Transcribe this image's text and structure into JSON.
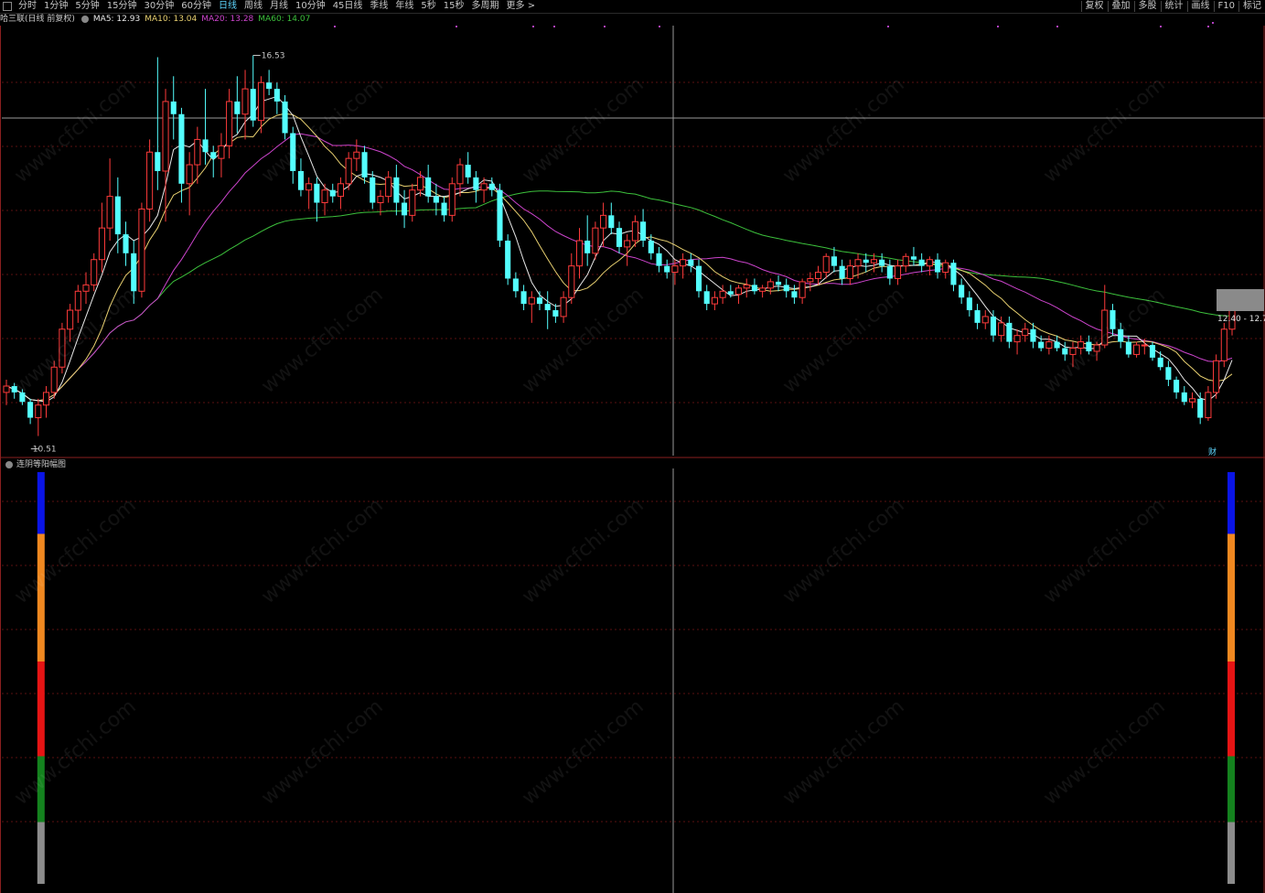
{
  "toolbar": {
    "items": [
      "分时",
      "1分钟",
      "5分钟",
      "15分钟",
      "30分钟",
      "60分钟",
      "日线",
      "周线",
      "月线",
      "10分钟",
      "45日线",
      "季线",
      "年线",
      "5秒",
      "15秒",
      "多周期",
      "更多 >"
    ],
    "active": "日线",
    "right_items": [
      "复权",
      "叠加",
      "多股",
      "统计",
      "画线",
      "F10",
      "标记"
    ]
  },
  "header": {
    "stock": "哈三联(日线 前复权)",
    "ma5": "MA5: 12.93",
    "ma10": "MA10: 13.04",
    "ma20": "MA20: 13.28",
    "ma60": "MA60: 14.07"
  },
  "labels": {
    "high": "16.53",
    "low": "10.51",
    "price_tag": "12.40 - 12.7",
    "cai": "财",
    "indicator": "连阴等阳幅图"
  },
  "colors": {
    "up": "#ff3b3b",
    "down": "#54ffff",
    "ma5": "#e8e8e8",
    "ma10": "#e8d070",
    "ma20": "#cc44cc",
    "ma60": "#3cc03c",
    "indicator_segments": [
      "#0a14e6",
      "#f08820",
      "#e61414",
      "#14821e",
      "#8c8c8c"
    ]
  },
  "chart_data": [
    {
      "type": "candlestick",
      "title": "哈三联(日线 前复权)",
      "ylim": [
        10.2,
        17.0
      ],
      "series": [
        {
          "name": "MA5",
          "last": 12.93
        },
        {
          "name": "MA10",
          "last": 13.04
        },
        {
          "name": "MA20",
          "last": 13.28
        },
        {
          "name": "MA60",
          "last": 14.07
        }
      ],
      "annotations": [
        {
          "label": "16.53",
          "kind": "high"
        },
        {
          "label": "10.51",
          "kind": "low"
        }
      ],
      "candles_ohlc": [
        [
          11.2,
          11.4,
          11.0,
          11.3
        ],
        [
          11.3,
          11.35,
          11.1,
          11.2
        ],
        [
          11.2,
          11.25,
          11.0,
          11.05
        ],
        [
          11.05,
          11.1,
          10.7,
          10.8
        ],
        [
          10.8,
          11.1,
          10.51,
          11.0
        ],
        [
          11.0,
          11.3,
          10.8,
          11.2
        ],
        [
          11.2,
          11.7,
          11.1,
          11.6
        ],
        [
          11.6,
          12.3,
          11.5,
          12.2
        ],
        [
          12.2,
          12.6,
          12.0,
          12.5
        ],
        [
          12.5,
          12.9,
          12.3,
          12.8
        ],
        [
          12.8,
          13.1,
          12.6,
          12.9
        ],
        [
          12.9,
          13.4,
          12.8,
          13.3
        ],
        [
          13.3,
          14.2,
          13.1,
          13.8
        ],
        [
          13.8,
          14.9,
          13.6,
          14.3
        ],
        [
          14.3,
          14.6,
          13.4,
          13.7
        ],
        [
          13.7,
          13.9,
          13.2,
          13.4
        ],
        [
          13.4,
          13.6,
          12.6,
          12.8
        ],
        [
          12.8,
          14.2,
          12.7,
          14.1
        ],
        [
          14.1,
          15.2,
          13.9,
          15.0
        ],
        [
          15.0,
          16.5,
          14.4,
          14.7
        ],
        [
          14.7,
          16.0,
          13.9,
          15.8
        ],
        [
          15.8,
          16.2,
          15.2,
          15.6
        ],
        [
          15.6,
          15.7,
          14.2,
          14.5
        ],
        [
          14.5,
          15.0,
          14.0,
          14.8
        ],
        [
          14.8,
          15.4,
          14.5,
          15.2
        ],
        [
          15.2,
          16.0,
          14.8,
          15.0
        ],
        [
          15.0,
          15.1,
          14.6,
          14.9
        ],
        [
          14.9,
          15.3,
          14.6,
          15.1
        ],
        [
          15.1,
          16.0,
          14.9,
          15.8
        ],
        [
          15.8,
          16.2,
          15.3,
          15.6
        ],
        [
          15.6,
          16.3,
          15.2,
          16.0
        ],
        [
          16.0,
          16.53,
          15.4,
          15.5
        ],
        [
          15.5,
          16.2,
          15.3,
          16.1
        ],
        [
          16.1,
          16.3,
          15.9,
          16.0
        ],
        [
          16.0,
          16.1,
          15.6,
          15.8
        ],
        [
          15.8,
          15.9,
          15.2,
          15.3
        ],
        [
          15.3,
          15.4,
          14.5,
          14.7
        ],
        [
          14.7,
          14.9,
          14.3,
          14.4
        ],
        [
          14.4,
          14.6,
          14.1,
          14.5
        ],
        [
          14.5,
          14.6,
          13.9,
          14.2
        ],
        [
          14.2,
          14.5,
          14.0,
          14.4
        ],
        [
          14.4,
          14.5,
          14.2,
          14.3
        ],
        [
          14.3,
          14.6,
          14.1,
          14.5
        ],
        [
          14.5,
          15.0,
          14.4,
          14.9
        ],
        [
          14.9,
          15.2,
          14.7,
          15.0
        ],
        [
          15.0,
          15.1,
          14.5,
          14.6
        ],
        [
          14.6,
          14.7,
          14.1,
          14.2
        ],
        [
          14.2,
          14.4,
          14.0,
          14.3
        ],
        [
          14.3,
          14.7,
          14.2,
          14.6
        ],
        [
          14.6,
          14.8,
          14.0,
          14.2
        ],
        [
          14.2,
          14.4,
          13.8,
          14.0
        ],
        [
          14.0,
          14.5,
          13.9,
          14.4
        ],
        [
          14.4,
          14.7,
          14.3,
          14.6
        ],
        [
          14.6,
          14.8,
          14.2,
          14.3
        ],
        [
          14.3,
          14.5,
          14.0,
          14.2
        ],
        [
          14.2,
          14.3,
          13.9,
          14.0
        ],
        [
          14.0,
          14.6,
          13.9,
          14.5
        ],
        [
          14.5,
          14.9,
          14.3,
          14.8
        ],
        [
          14.8,
          15.0,
          14.5,
          14.6
        ],
        [
          14.6,
          14.7,
          14.2,
          14.4
        ],
        [
          14.4,
          14.6,
          14.2,
          14.5
        ],
        [
          14.5,
          14.6,
          14.3,
          14.4
        ],
        [
          14.4,
          14.5,
          13.5,
          13.6
        ],
        [
          13.6,
          13.7,
          12.9,
          13.0
        ],
        [
          13.0,
          13.1,
          12.7,
          12.8
        ],
        [
          12.8,
          12.9,
          12.5,
          12.6
        ],
        [
          12.6,
          12.8,
          12.3,
          12.7
        ],
        [
          12.7,
          12.8,
          12.5,
          12.6
        ],
        [
          12.6,
          12.8,
          12.2,
          12.5
        ],
        [
          12.5,
          12.6,
          12.3,
          12.4
        ],
        [
          12.4,
          12.8,
          12.3,
          12.7
        ],
        [
          12.7,
          13.4,
          12.6,
          13.2
        ],
        [
          13.2,
          13.8,
          13.0,
          13.6
        ],
        [
          13.6,
          14.0,
          13.2,
          13.4
        ],
        [
          13.4,
          13.9,
          13.3,
          13.8
        ],
        [
          13.8,
          14.2,
          13.5,
          14.0
        ],
        [
          14.0,
          14.2,
          13.7,
          13.8
        ],
        [
          13.8,
          13.9,
          13.4,
          13.5
        ],
        [
          13.5,
          13.7,
          13.2,
          13.6
        ],
        [
          13.6,
          14.0,
          13.5,
          13.9
        ],
        [
          13.9,
          14.1,
          13.5,
          13.6
        ],
        [
          13.6,
          13.7,
          13.3,
          13.4
        ],
        [
          13.4,
          13.5,
          13.1,
          13.2
        ],
        [
          13.2,
          13.3,
          13.0,
          13.1
        ],
        [
          13.1,
          13.3,
          12.9,
          13.2
        ],
        [
          13.2,
          13.4,
          13.0,
          13.3
        ],
        [
          13.3,
          13.4,
          13.1,
          13.2
        ],
        [
          13.2,
          13.3,
          12.7,
          12.8
        ],
        [
          12.8,
          12.9,
          12.5,
          12.6
        ],
        [
          12.6,
          12.8,
          12.5,
          12.7
        ],
        [
          12.7,
          12.9,
          12.6,
          12.8
        ],
        [
          12.8,
          12.9,
          12.7,
          12.75
        ],
        [
          12.75,
          12.9,
          12.6,
          12.85
        ],
        [
          12.85,
          13.0,
          12.7,
          12.9
        ],
        [
          12.9,
          13.0,
          12.75,
          12.8
        ],
        [
          12.8,
          12.9,
          12.7,
          12.85
        ],
        [
          12.85,
          13.0,
          12.75,
          12.95
        ],
        [
          12.95,
          13.05,
          12.8,
          12.9
        ],
        [
          12.9,
          13.0,
          12.7,
          12.8
        ],
        [
          12.8,
          12.9,
          12.6,
          12.7
        ],
        [
          12.7,
          13.0,
          12.6,
          12.95
        ],
        [
          12.95,
          13.1,
          12.8,
          13.0
        ],
        [
          13.0,
          13.2,
          12.9,
          13.1
        ],
        [
          13.1,
          13.4,
          13.0,
          13.35
        ],
        [
          13.35,
          13.5,
          13.1,
          13.2
        ],
        [
          13.2,
          13.3,
          12.9,
          13.0
        ],
        [
          13.0,
          13.3,
          12.9,
          13.2
        ],
        [
          13.2,
          13.4,
          13.0,
          13.3
        ],
        [
          13.3,
          13.4,
          13.1,
          13.25
        ],
        [
          13.25,
          13.4,
          13.1,
          13.3
        ],
        [
          13.3,
          13.4,
          13.1,
          13.2
        ],
        [
          13.2,
          13.3,
          12.9,
          13.0
        ],
        [
          13.0,
          13.3,
          12.9,
          13.2
        ],
        [
          13.2,
          13.4,
          13.1,
          13.35
        ],
        [
          13.35,
          13.5,
          13.2,
          13.3
        ],
        [
          13.3,
          13.4,
          13.1,
          13.2
        ],
        [
          13.2,
          13.35,
          13.05,
          13.3
        ],
        [
          13.3,
          13.4,
          13.0,
          13.1
        ],
        [
          13.1,
          13.3,
          13.0,
          13.25
        ],
        [
          13.25,
          13.3,
          12.8,
          12.9
        ],
        [
          12.9,
          13.0,
          12.6,
          12.7
        ],
        [
          12.7,
          12.8,
          12.4,
          12.5
        ],
        [
          12.5,
          12.6,
          12.2,
          12.3
        ],
        [
          12.3,
          12.5,
          12.2,
          12.4
        ],
        [
          12.4,
          12.5,
          12.0,
          12.1
        ],
        [
          12.1,
          12.4,
          12.0,
          12.3
        ],
        [
          12.3,
          12.4,
          11.9,
          12.0
        ],
        [
          12.0,
          12.2,
          11.8,
          12.1
        ],
        [
          12.1,
          12.3,
          12.0,
          12.2
        ],
        [
          12.2,
          12.3,
          11.9,
          12.0
        ],
        [
          12.0,
          12.1,
          11.85,
          11.9
        ],
        [
          11.9,
          12.1,
          11.8,
          12.0
        ],
        [
          12.0,
          12.1,
          11.85,
          11.9
        ],
        [
          11.9,
          12.0,
          11.7,
          11.8
        ],
        [
          11.8,
          12.0,
          11.6,
          11.9
        ],
        [
          11.9,
          12.1,
          11.8,
          12.0
        ],
        [
          12.0,
          12.1,
          11.8,
          11.85
        ],
        [
          11.85,
          12.0,
          11.7,
          11.95
        ],
        [
          11.95,
          12.9,
          11.9,
          12.5
        ],
        [
          12.5,
          12.6,
          12.1,
          12.2
        ],
        [
          12.2,
          12.3,
          11.9,
          12.0
        ],
        [
          12.0,
          12.1,
          11.75,
          11.8
        ],
        [
          11.8,
          12.0,
          11.75,
          11.95
        ],
        [
          11.95,
          12.05,
          11.8,
          11.95
        ],
        [
          11.95,
          12.0,
          11.7,
          11.75
        ],
        [
          11.75,
          11.85,
          11.55,
          11.6
        ],
        [
          11.6,
          11.7,
          11.3,
          11.4
        ],
        [
          11.4,
          11.45,
          11.1,
          11.2
        ],
        [
          11.2,
          11.3,
          11.0,
          11.05
        ],
        [
          11.05,
          11.2,
          10.95,
          11.1
        ],
        [
          11.1,
          11.2,
          10.7,
          10.8
        ],
        [
          10.8,
          11.3,
          10.75,
          11.2
        ],
        [
          11.2,
          11.8,
          11.1,
          11.7
        ],
        [
          11.7,
          12.3,
          11.6,
          12.2
        ],
        [
          12.2,
          12.8,
          12.1,
          12.65
        ]
      ]
    },
    {
      "type": "bar",
      "title": "连阴等阳幅图",
      "segments_colors": [
        "blue",
        "orange",
        "red",
        "green",
        "gray"
      ],
      "segment_fractions": [
        0.15,
        0.31,
        0.23,
        0.16,
        0.15
      ],
      "bars_at_candle_index": [
        4,
        154
      ]
    }
  ]
}
